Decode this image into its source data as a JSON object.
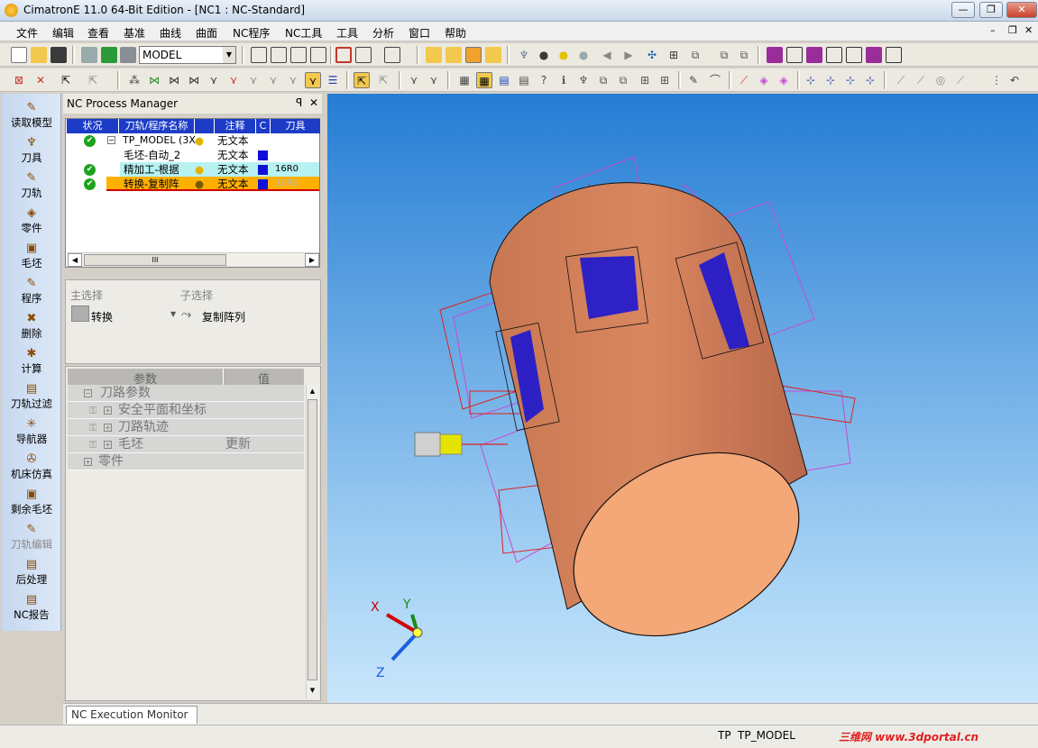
{
  "title": "CimatronE 11.0 64-Bit Edition - [NC1 : NC-Standard]",
  "window_buttons": {
    "minimize": "—",
    "restore": "❐",
    "close": "✕"
  },
  "menu": [
    "文件",
    "编辑",
    "查看",
    "基准",
    "曲线",
    "曲面",
    "NC程序",
    "NC工具",
    "工具",
    "分析",
    "窗口",
    "帮助"
  ],
  "model_combo": "MODEL",
  "sidebar": [
    {
      "label": "读取模型",
      "icon": "✎"
    },
    {
      "label": "刀具",
      "icon": "♆"
    },
    {
      "label": "刀轨",
      "icon": "✎"
    },
    {
      "label": "零件",
      "icon": "◈"
    },
    {
      "label": "毛坯",
      "icon": "▣"
    },
    {
      "label": "程序",
      "icon": "✎"
    },
    {
      "label": "删除",
      "icon": "✖"
    },
    {
      "label": "计算",
      "icon": "✱"
    },
    {
      "label": "刀轨过滤",
      "icon": "▤"
    },
    {
      "label": "导航器",
      "icon": "✳"
    },
    {
      "label": "机床仿真",
      "icon": "✇"
    },
    {
      "label": "剩余毛坯",
      "icon": "▣"
    },
    {
      "label": "刀轨编辑",
      "icon": "✎"
    },
    {
      "label": "后处理",
      "icon": "▤"
    },
    {
      "label": "NC报告",
      "icon": "▤"
    }
  ],
  "npm": {
    "title": "NC Process Manager",
    "pin": "ꟼ",
    "close": "✕"
  },
  "tree": {
    "headers": [
      "状况",
      "刀轨/程序名称",
      "",
      "注释",
      "C",
      "刀具"
    ],
    "rows": [
      {
        "name": "TP_MODEL (3X",
        "comment": "无文本",
        "tool": ""
      },
      {
        "name": "毛坯-自动_2",
        "comment": "无文本",
        "tool": ""
      },
      {
        "name": "精加工-根据",
        "comment": "无文本",
        "tool": "16R0"
      },
      {
        "name": "转换-复制阵",
        "comment": "无文本",
        "tool": "16R0"
      }
    ],
    "scroll_grip": "III"
  },
  "selection": {
    "main_label": "主选择",
    "sub_label": "子选择",
    "main_value": "转换",
    "sub_value": "复制阵列"
  },
  "params": {
    "headers": [
      "参数",
      "值"
    ],
    "rows": [
      {
        "label": "刀路参数",
        "value": ""
      },
      {
        "label": "安全平面和坐标",
        "value": ""
      },
      {
        "label": "刀路轨迹",
        "value": ""
      },
      {
        "label": "毛坯",
        "value": "更新"
      },
      {
        "label": "零件",
        "value": ""
      }
    ]
  },
  "axes": {
    "x": "X",
    "y": "Y",
    "z": "Z"
  },
  "monitor_tab": "NC Execution Monitor",
  "status": {
    "tp": "TP",
    "model": "TP_MODEL",
    "watermark": "三维网 www.3dportal.cn"
  },
  "colors": {
    "cylinder": "#d9875f",
    "toolpath": "#1010d8",
    "fixture": "#c64bd4",
    "selected_row": "#ffb000",
    "viewport_top": "#257dd4"
  }
}
